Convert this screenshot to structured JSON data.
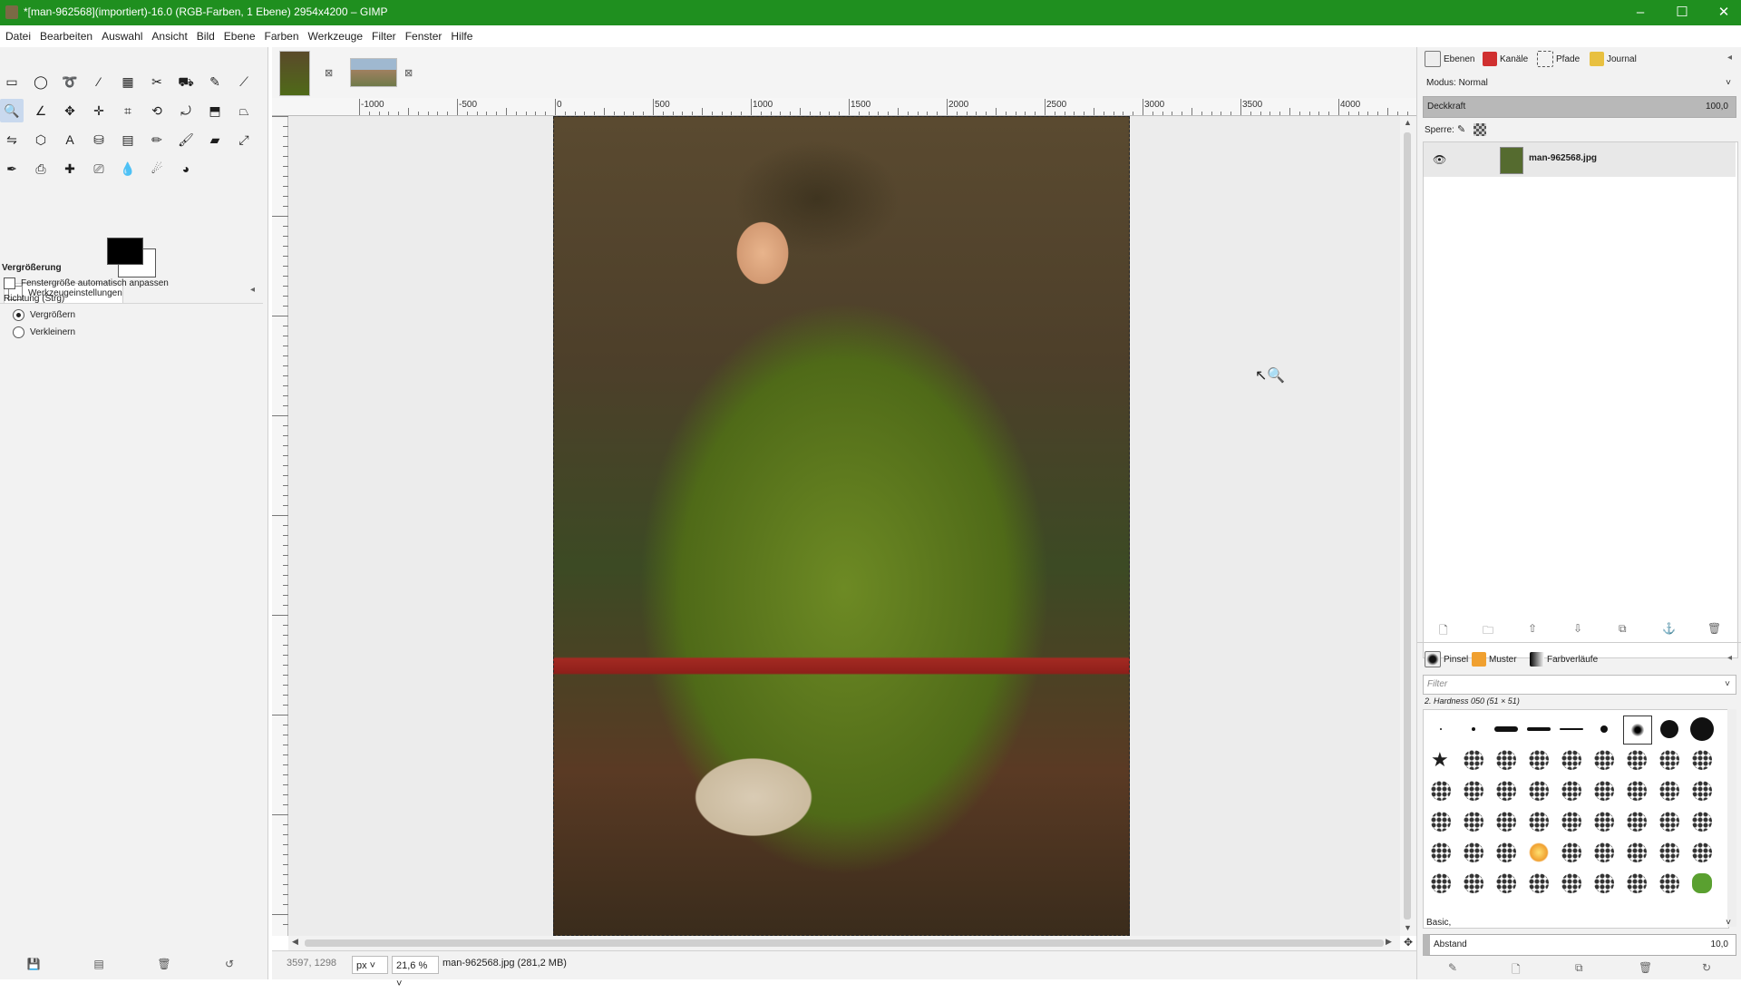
{
  "window": {
    "title": "*[man-962568](importiert)-16.0 (RGB-Farben, 1 Ebene) 2954x4200 – GIMP",
    "controls": {
      "minimize": "–",
      "maximize": "☐",
      "close": "✕"
    }
  },
  "menubar": [
    "Datei",
    "Bearbeiten",
    "Auswahl",
    "Ansicht",
    "Bild",
    "Ebene",
    "Farben",
    "Werkzeuge",
    "Filter",
    "Fenster",
    "Hilfe"
  ],
  "toolbox": {
    "tools": [
      {
        "name": "rect-select-icon",
        "glyph": "▭"
      },
      {
        "name": "ellipse-select-icon",
        "glyph": "◯"
      },
      {
        "name": "free-select-icon",
        "glyph": "➰"
      },
      {
        "name": "fuzzy-select-icon",
        "glyph": "⁄"
      },
      {
        "name": "color-select-icon",
        "glyph": "▦"
      },
      {
        "name": "scissors-icon",
        "glyph": "✂"
      },
      {
        "name": "foreground-select-icon",
        "glyph": "⛟"
      },
      {
        "name": "paths-icon",
        "glyph": "✎"
      },
      {
        "name": "color-picker-icon",
        "glyph": "⟋"
      },
      {
        "name": "zoom-icon",
        "glyph": "🔍",
        "active": true
      },
      {
        "name": "measure-icon",
        "glyph": "∠"
      },
      {
        "name": "move-icon",
        "glyph": "✥"
      },
      {
        "name": "align-icon",
        "glyph": "✛"
      },
      {
        "name": "crop-icon",
        "glyph": "⌗"
      },
      {
        "name": "unified-transform-icon",
        "glyph": "⟲"
      },
      {
        "name": "rotate-icon",
        "glyph": "⤾"
      },
      {
        "name": "scale-icon",
        "glyph": "⬒"
      },
      {
        "name": "perspective-icon",
        "glyph": "⏢"
      },
      {
        "name": "flip-icon",
        "glyph": "⇋"
      },
      {
        "name": "cage-icon",
        "glyph": "⬡"
      },
      {
        "name": "text-icon",
        "glyph": "A"
      },
      {
        "name": "bucket-fill-icon",
        "glyph": "⛁"
      },
      {
        "name": "gradient-icon",
        "glyph": "▤"
      },
      {
        "name": "pencil-icon",
        "glyph": "✏"
      },
      {
        "name": "paintbrush-icon",
        "glyph": "🖌"
      },
      {
        "name": "eraser-icon",
        "glyph": "▰"
      },
      {
        "name": "airbrush-icon",
        "glyph": "⤢"
      },
      {
        "name": "ink-icon",
        "glyph": "✒"
      },
      {
        "name": "clone-icon",
        "glyph": "⎙"
      },
      {
        "name": "heal-icon",
        "glyph": "✚"
      },
      {
        "name": "perspective-clone-icon",
        "glyph": "⎚"
      },
      {
        "name": "blur-icon",
        "glyph": "💧"
      },
      {
        "name": "smudge-icon",
        "glyph": "☄"
      },
      {
        "name": "dodge-burn-icon",
        "glyph": "◕"
      }
    ]
  },
  "tool_options": {
    "tab_label": "Werkzeugeinstellungen",
    "title": "Vergrößerung",
    "auto_resize": "Fenstergröße automatisch anpassen",
    "direction_label": "Richtung (Strg)",
    "zoom_in": "Vergrößern",
    "zoom_out": "Verkleinern"
  },
  "ruler": {
    "labels": [
      "-1000",
      "-500",
      "0",
      "500",
      "1000",
      "1500",
      "2000",
      "2500",
      "3000",
      "3500",
      "4000"
    ]
  },
  "statusbar": {
    "coords": "3597, 1298",
    "unit": "px",
    "zoom": "21,6 %",
    "info": "man-962568.jpg (281,2 MB)"
  },
  "layers_panel": {
    "tabs": [
      "Ebenen",
      "Kanäle",
      "Pfade",
      "Journal"
    ],
    "mode_label": "Modus: Normal",
    "opacity_label": "Deckkraft",
    "opacity_value": "100,0",
    "lock_label": "Sperre:",
    "layers": [
      {
        "name": "man-962568.jpg",
        "visible": true
      }
    ]
  },
  "brushes_panel": {
    "tabs": [
      "Pinsel",
      "Muster",
      "Farbverläufe"
    ],
    "filter_placeholder": "Filter",
    "selected_brush": "2. Hardness 050 (51 × 51)",
    "preset": "Basic,",
    "spacing_label": "Abstand",
    "spacing_value": "10,0"
  }
}
